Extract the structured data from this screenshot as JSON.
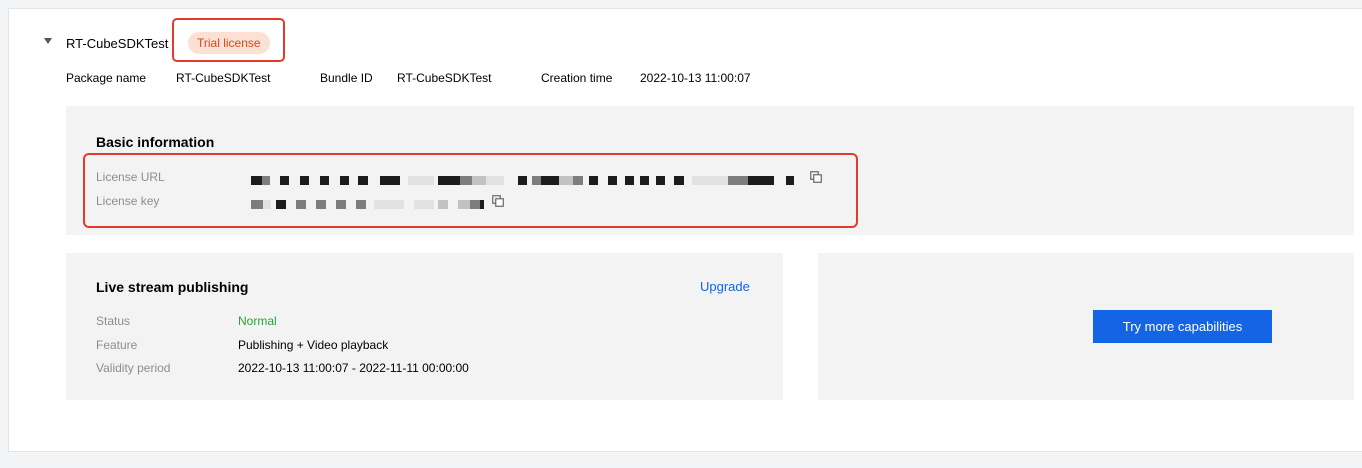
{
  "app": {
    "name": "RT-CubeSDKTest",
    "license_badge": "Trial license",
    "package_name_label": "Package name",
    "package_name": "RT-CubeSDKTest",
    "bundle_id_label": "Bundle ID",
    "bundle_id": "RT-CubeSDKTest",
    "creation_time_label": "Creation time",
    "creation_time": "2022-10-13 11:00:07"
  },
  "basic_info": {
    "title": "Basic information",
    "license_url_label": "License URL",
    "license_key_label": "License key",
    "copy_icon": "copy-icon"
  },
  "publishing": {
    "title": "Live stream publishing",
    "upgrade_label": "Upgrade",
    "status_label": "Status",
    "status_value": "Normal",
    "feature_label": "Feature",
    "feature_value": "Publishing + Video playback",
    "validity_label": "Validity period",
    "validity_value": "2022-10-13 11:00:07 - 2022-11-11 00:00:00"
  },
  "try_more": {
    "button_label": "Try more capabilities"
  },
  "colors": {
    "accent": "#1464e6",
    "badge_bg": "#fbe1d3",
    "badge_text": "#d2491f",
    "highlight": "#e23a2d",
    "status_normal": "#27a33a"
  }
}
